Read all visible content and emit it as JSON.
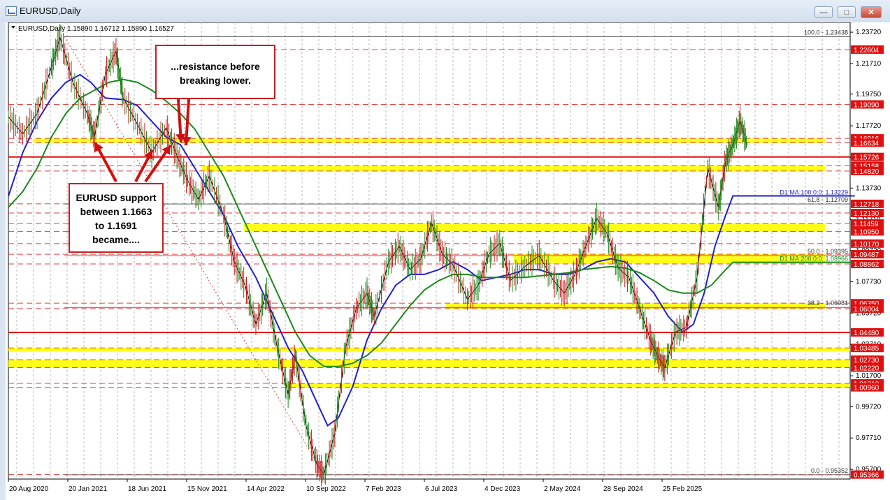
{
  "window": {
    "title": "EURUSD,Daily"
  },
  "chart_data": {
    "type": "line",
    "symbol": "EURUSD",
    "timeframe": "Daily",
    "ohlc_header": "EURUSD,Daily  1.15890 1.16712 1.15890 1.16527",
    "ylim": [
      0.9508,
      1.2435
    ],
    "y_ticks": [
      "1.23720",
      "1.21710",
      "1.19750",
      "1.17720",
      "1.15700",
      "1.13730",
      "1.11710",
      "1.09720",
      "1.07730",
      "1.05720",
      "1.03710",
      "1.01700",
      "0.99720",
      "0.97710",
      "0.95700"
    ],
    "x_labels": [
      "20 Aug 2020",
      "20 Jan 2021",
      "18 Jun 2021",
      "15 Nov 2021",
      "14 Apr 2022",
      "10 Sep 2022",
      "7 Feb 2023",
      "6 Jul 2023",
      "4 Dec 2023",
      "2 May 2024",
      "28 Sep 2024",
      "25 Feb 2025"
    ],
    "x_label_positions": [
      0,
      1,
      2,
      3,
      4,
      5,
      6,
      7,
      8,
      9,
      10,
      11
    ],
    "price_tags": [
      {
        "value": 1.22604,
        "text": "1.22604"
      },
      {
        "value": 1.1909,
        "text": "1.19090"
      },
      {
        "value": 1.16916,
        "text": "1.16916"
      },
      {
        "value": 1.16634,
        "text": "1.16634"
      },
      {
        "value": 1.15726,
        "text": "1.15726"
      },
      {
        "value": 1.15158,
        "text": "1.15158"
      },
      {
        "value": 1.1482,
        "text": "1.14820"
      },
      {
        "value": 1.12718,
        "text": "1.12718"
      },
      {
        "value": 1.1213,
        "text": "1.12130"
      },
      {
        "value": 1.11459,
        "text": "1.11459"
      },
      {
        "value": 1.1095,
        "text": "1.10950"
      },
      {
        "value": 1.1017,
        "text": "1.10170"
      },
      {
        "value": 1.09487,
        "text": "1.09487"
      },
      {
        "value": 1.08862,
        "text": "1.08862"
      },
      {
        "value": 1.0635,
        "text": "1.06350"
      },
      {
        "value": 1.06004,
        "text": "1.06004"
      },
      {
        "value": 1.0448,
        "text": "1.04480"
      },
      {
        "value": 1.03485,
        "text": "1.03485"
      },
      {
        "value": 1.0273,
        "text": "1.02730"
      },
      {
        "value": 1.0222,
        "text": "1.02220"
      },
      {
        "value": 1.0121,
        "text": "1.01210"
      },
      {
        "value": 1.0096,
        "text": "1.00960"
      },
      {
        "value": 0.95366,
        "text": "0.95366"
      }
    ],
    "fib_levels": [
      {
        "value": 1.23438,
        "text": "100.0 - 1.23438"
      },
      {
        "value": 1.12709,
        "text": "61.8 - 1.12709"
      },
      {
        "value": 1.09395,
        "text": "50.0 - 1.09395"
      },
      {
        "value": 1.06081,
        "text": "38.2 - 1.06081"
      },
      {
        "value": 0.95352,
        "text": "0.0 - 0.95352"
      }
    ],
    "ma_labels": [
      {
        "value": 1.13229,
        "text": "D1 MA:100:0:0: 1.13229",
        "color": "#1f1fd0"
      },
      {
        "value": 1.08966,
        "text": "D1 MA:200:0:0: 1.08966",
        "color": "#1a8a1a"
      }
    ],
    "zones": [
      {
        "lo": 1.1663,
        "hi": 1.1691,
        "x0": 0.03,
        "x1": 0.97
      },
      {
        "lo": 1.1482,
        "hi": 1.1516,
        "x0": 0.23,
        "x1": 0.97
      },
      {
        "lo": 1.1095,
        "hi": 1.1146,
        "x0": 0.28,
        "x1": 0.97
      },
      {
        "lo": 1.0886,
        "hi": 1.0949,
        "x0": 0.6,
        "x1": 0.97
      },
      {
        "lo": 1.06,
        "hi": 1.0635,
        "x0": 0.52,
        "x1": 0.97
      },
      {
        "lo": 1.034,
        "hi": 1.0349,
        "x0": 0.0,
        "x1": 1.0
      },
      {
        "lo": 1.0222,
        "hi": 1.0273,
        "x0": 0.0,
        "x1": 1.0
      },
      {
        "lo": 1.0096,
        "hi": 1.0121,
        "x0": 0.33,
        "x1": 1.0
      }
    ],
    "red_lines": [
      1.22604,
      1.1909,
      1.15726,
      1.1213,
      1.1017,
      1.0448
    ],
    "series": [
      {
        "name": "price",
        "color": "#000000",
        "points": [
          [
            0.0,
            1.183
          ],
          [
            0.02,
            1.172
          ],
          [
            0.04,
            1.185
          ],
          [
            0.06,
            1.215
          ],
          [
            0.072,
            1.234
          ],
          [
            0.09,
            1.205
          ],
          [
            0.11,
            1.185
          ],
          [
            0.12,
            1.17
          ],
          [
            0.135,
            1.21
          ],
          [
            0.15,
            1.225
          ],
          [
            0.16,
            1.195
          ],
          [
            0.18,
            1.178
          ],
          [
            0.2,
            1.16
          ],
          [
            0.22,
            1.176
          ],
          [
            0.235,
            1.158
          ],
          [
            0.25,
            1.142
          ],
          [
            0.265,
            1.13
          ],
          [
            0.28,
            1.145
          ],
          [
            0.3,
            1.12
          ],
          [
            0.315,
            1.09
          ],
          [
            0.33,
            1.075
          ],
          [
            0.345,
            1.05
          ],
          [
            0.36,
            1.07
          ],
          [
            0.375,
            1.035
          ],
          [
            0.39,
            1.005
          ],
          [
            0.4,
            1.03
          ],
          [
            0.415,
            0.985
          ],
          [
            0.43,
            0.96
          ],
          [
            0.44,
            0.954
          ],
          [
            0.455,
            0.98
          ],
          [
            0.47,
            1.035
          ],
          [
            0.485,
            1.06
          ],
          [
            0.5,
            1.07
          ],
          [
            0.51,
            1.055
          ],
          [
            0.53,
            1.09
          ],
          [
            0.545,
            1.1
          ],
          [
            0.56,
            1.085
          ],
          [
            0.575,
            1.092
          ],
          [
            0.59,
            1.115
          ],
          [
            0.605,
            1.095
          ],
          [
            0.62,
            1.088
          ],
          [
            0.64,
            1.066
          ],
          [
            0.655,
            1.075
          ],
          [
            0.67,
            1.095
          ],
          [
            0.685,
            1.102
          ],
          [
            0.7,
            1.078
          ],
          [
            0.72,
            1.087
          ],
          [
            0.74,
            1.094
          ],
          [
            0.76,
            1.078
          ],
          [
            0.775,
            1.07
          ],
          [
            0.79,
            1.082
          ],
          [
            0.805,
            1.1
          ],
          [
            0.82,
            1.118
          ],
          [
            0.835,
            1.108
          ],
          [
            0.85,
            1.086
          ],
          [
            0.865,
            1.08
          ],
          [
            0.88,
            1.06
          ],
          [
            0.895,
            1.04
          ],
          [
            0.905,
            1.03
          ],
          [
            0.915,
            1.022
          ],
          [
            0.93,
            1.045
          ],
          [
            0.945,
            1.048
          ],
          [
            0.96,
            1.08
          ],
          [
            0.975,
            1.15
          ],
          [
            0.99,
            1.125
          ],
          [
            1.0,
            1.155
          ],
          [
            1.01,
            1.165
          ],
          [
            1.02,
            1.18
          ],
          [
            1.03,
            1.165
          ]
        ]
      },
      {
        "name": "D1 MA:100:0:0",
        "color": "#1f1fd0",
        "points": [
          [
            0.0,
            1.132
          ],
          [
            0.02,
            1.16
          ],
          [
            0.04,
            1.18
          ],
          [
            0.06,
            1.195
          ],
          [
            0.08,
            1.205
          ],
          [
            0.1,
            1.21
          ],
          [
            0.115,
            1.205
          ],
          [
            0.135,
            1.195
          ],
          [
            0.16,
            1.194
          ],
          [
            0.18,
            1.19
          ],
          [
            0.2,
            1.18
          ],
          [
            0.22,
            1.17
          ],
          [
            0.24,
            1.165
          ],
          [
            0.26,
            1.15
          ],
          [
            0.28,
            1.135
          ],
          [
            0.3,
            1.12
          ],
          [
            0.32,
            1.1
          ],
          [
            0.345,
            1.08
          ],
          [
            0.37,
            1.055
          ],
          [
            0.39,
            1.035
          ],
          [
            0.41,
            1.02
          ],
          [
            0.43,
            1.0
          ],
          [
            0.445,
            0.985
          ],
          [
            0.46,
            0.99
          ],
          [
            0.48,
            1.01
          ],
          [
            0.5,
            1.04
          ],
          [
            0.52,
            1.06
          ],
          [
            0.54,
            1.075
          ],
          [
            0.56,
            1.082
          ],
          [
            0.58,
            1.082
          ],
          [
            0.6,
            1.085
          ],
          [
            0.62,
            1.09
          ],
          [
            0.64,
            1.085
          ],
          [
            0.66,
            1.078
          ],
          [
            0.68,
            1.08
          ],
          [
            0.7,
            1.082
          ],
          [
            0.72,
            1.085
          ],
          [
            0.74,
            1.085
          ],
          [
            0.76,
            1.082
          ],
          [
            0.78,
            1.082
          ],
          [
            0.8,
            1.085
          ],
          [
            0.82,
            1.09
          ],
          [
            0.84,
            1.092
          ],
          [
            0.86,
            1.09
          ],
          [
            0.88,
            1.08
          ],
          [
            0.9,
            1.07
          ],
          [
            0.92,
            1.055
          ],
          [
            0.94,
            1.045
          ],
          [
            0.955,
            1.05
          ],
          [
            0.97,
            1.07
          ],
          [
            0.985,
            1.1
          ],
          [
            1.0,
            1.12
          ],
          [
            1.01,
            1.1323
          ],
          [
            1.18,
            1.1323
          ]
        ]
      },
      {
        "name": "D1 MA:200:0:0",
        "color": "#1a8a1a",
        "points": [
          [
            0.0,
            1.125
          ],
          [
            0.02,
            1.135
          ],
          [
            0.04,
            1.15
          ],
          [
            0.06,
            1.17
          ],
          [
            0.08,
            1.185
          ],
          [
            0.1,
            1.195
          ],
          [
            0.12,
            1.2
          ],
          [
            0.14,
            1.205
          ],
          [
            0.16,
            1.207
          ],
          [
            0.18,
            1.205
          ],
          [
            0.2,
            1.2
          ],
          [
            0.22,
            1.193
          ],
          [
            0.24,
            1.185
          ],
          [
            0.26,
            1.175
          ],
          [
            0.28,
            1.16
          ],
          [
            0.3,
            1.145
          ],
          [
            0.32,
            1.125
          ],
          [
            0.34,
            1.105
          ],
          [
            0.36,
            1.085
          ],
          [
            0.38,
            1.065
          ],
          [
            0.4,
            1.045
          ],
          [
            0.42,
            1.03
          ],
          [
            0.44,
            1.023
          ],
          [
            0.46,
            1.023
          ],
          [
            0.48,
            1.025
          ],
          [
            0.5,
            1.03
          ],
          [
            0.52,
            1.038
          ],
          [
            0.54,
            1.05
          ],
          [
            0.56,
            1.062
          ],
          [
            0.58,
            1.072
          ],
          [
            0.6,
            1.078
          ],
          [
            0.62,
            1.082
          ],
          [
            0.64,
            1.082
          ],
          [
            0.66,
            1.08
          ],
          [
            0.68,
            1.08
          ],
          [
            0.7,
            1.08
          ],
          [
            0.72,
            1.08
          ],
          [
            0.74,
            1.081
          ],
          [
            0.76,
            1.082
          ],
          [
            0.78,
            1.083
          ],
          [
            0.8,
            1.085
          ],
          [
            0.82,
            1.086
          ],
          [
            0.84,
            1.087
          ],
          [
            0.86,
            1.086
          ],
          [
            0.88,
            1.083
          ],
          [
            0.9,
            1.078
          ],
          [
            0.92,
            1.072
          ],
          [
            0.94,
            1.07
          ],
          [
            0.96,
            1.07
          ],
          [
            0.98,
            1.075
          ],
          [
            1.0,
            1.085
          ],
          [
            1.01,
            1.0897
          ],
          [
            1.18,
            1.0897
          ]
        ]
      }
    ]
  },
  "annotations": {
    "support": [
      "EURUSD support",
      "between 1.1663",
      "to 1.1691",
      "became...."
    ],
    "resistance": [
      "...resistance before",
      "breaking lower."
    ]
  }
}
